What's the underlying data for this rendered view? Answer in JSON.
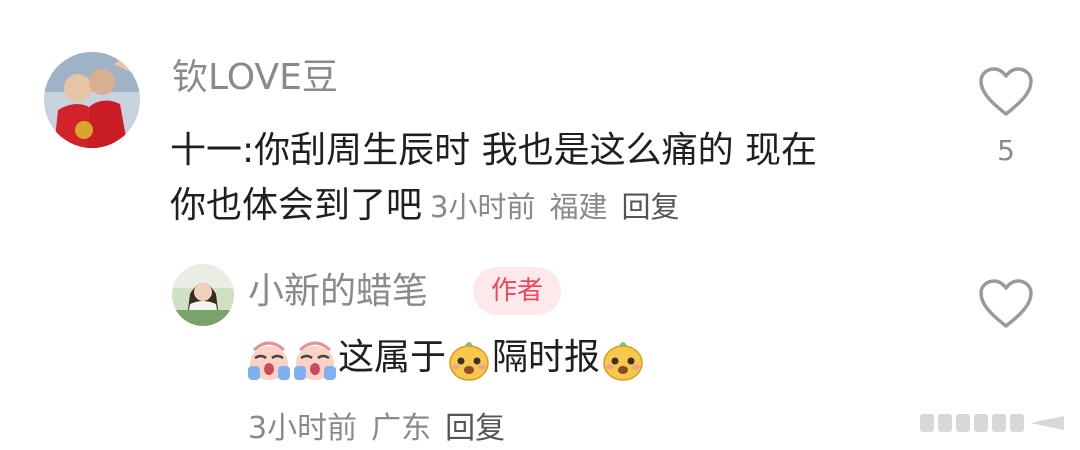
{
  "comments": [
    {
      "username": "钦LOVE豆",
      "text_line1": "十一:你刮周生辰时 我也是这么痛的 现在",
      "text_line2": "你也体会到了吧",
      "time": "3小时前",
      "location": "福建",
      "reply_label": "回复",
      "like_count": "5",
      "avatar_icon": "avatar-photo-icon"
    },
    {
      "username": "小新的蜡笔",
      "badge": "作者",
      "text_part1": "这属于",
      "text_part2": "隔时报",
      "time": "3小时前",
      "location": "广东",
      "reply_label": "回复",
      "avatar_icon": "avatar-photo-icon"
    }
  ],
  "icons": {
    "like": "heart-outline-icon",
    "cry_emoji": "crying-emoji-icon",
    "smile_emoji": "yellow-smile-emoji-icon",
    "watermark": "app-watermark-icon"
  },
  "colors": {
    "username": "#8a8a8a",
    "text": "#1f1f1f",
    "badge_bg": "#fde9ec",
    "badge_text": "#f0475f"
  }
}
